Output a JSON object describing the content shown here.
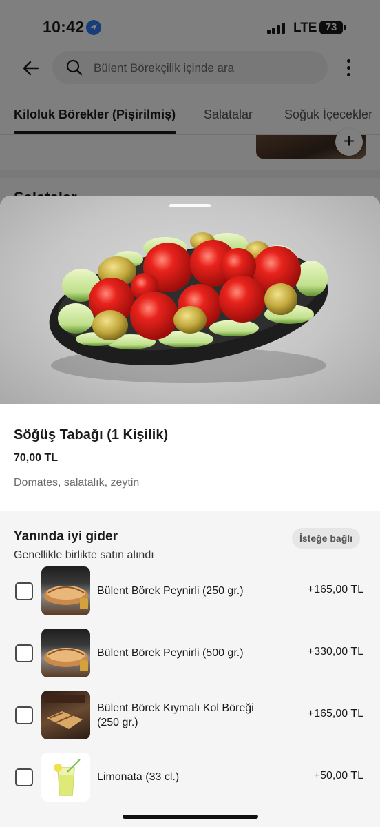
{
  "status_bar": {
    "time": "10:42",
    "network": "LTE",
    "battery": "73"
  },
  "search": {
    "placeholder": "Bülent Börekçilik içinde ara"
  },
  "tabs": [
    {
      "label": "Kiloluk Börekler (Pişirilmiş)"
    },
    {
      "label": "Salatalar"
    },
    {
      "label": "Soğuk İçecekler"
    }
  ],
  "background": {
    "section_title": "Salatalar",
    "add_label": "+"
  },
  "item": {
    "title": "Söğüş Tabağı (1 Kişilik)",
    "price": "70,00 TL",
    "description": "Domates, salatalık, zeytin"
  },
  "addons": {
    "title": "Yanında iyi gider",
    "subtitle": "Genellikle birlikte satın alındı",
    "badge": "İsteğe bağlı",
    "options": [
      {
        "name": "Bülent Börek Peynirli (250 gr.)",
        "price": "+165,00 TL",
        "checked": false
      },
      {
        "name": "Bülent Börek Peynirli (500 gr.)",
        "price": "+330,00 TL",
        "checked": false
      },
      {
        "name": "Bülent Börek Kıymalı Kol Böreği (250 gr.)",
        "price": "+165,00 TL",
        "checked": false
      },
      {
        "name": "Limonata (33 cl.)",
        "price": "+50,00 TL",
        "checked": false
      }
    ]
  },
  "colors": {
    "accent_blue": "#2f7cf6",
    "addons_bg": "#f5f5f5",
    "dim_overlay": "rgba(0,0,0,0.5)"
  }
}
